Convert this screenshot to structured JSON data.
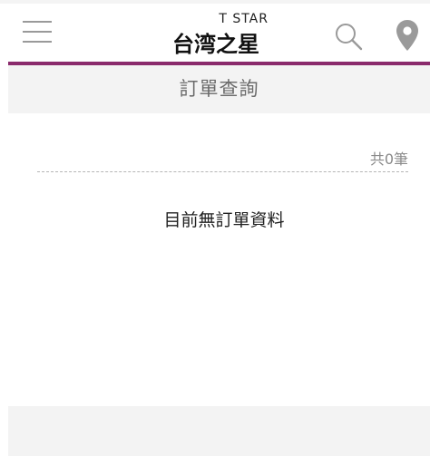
{
  "colors": {
    "accent": "#8a2a6c",
    "icon_gray": "#9a9a9a",
    "panel_bg": "#f3f3f3"
  },
  "header": {
    "menu_icon": "hamburger-menu-icon",
    "logo_en": "T STAR",
    "logo_zh": "台湾之星",
    "search_icon": "search-icon",
    "location_icon": "map-pin-icon"
  },
  "page": {
    "title": "訂單查詢"
  },
  "orders": {
    "count_label": "共0筆",
    "empty_message": "目前無訂單資料"
  }
}
